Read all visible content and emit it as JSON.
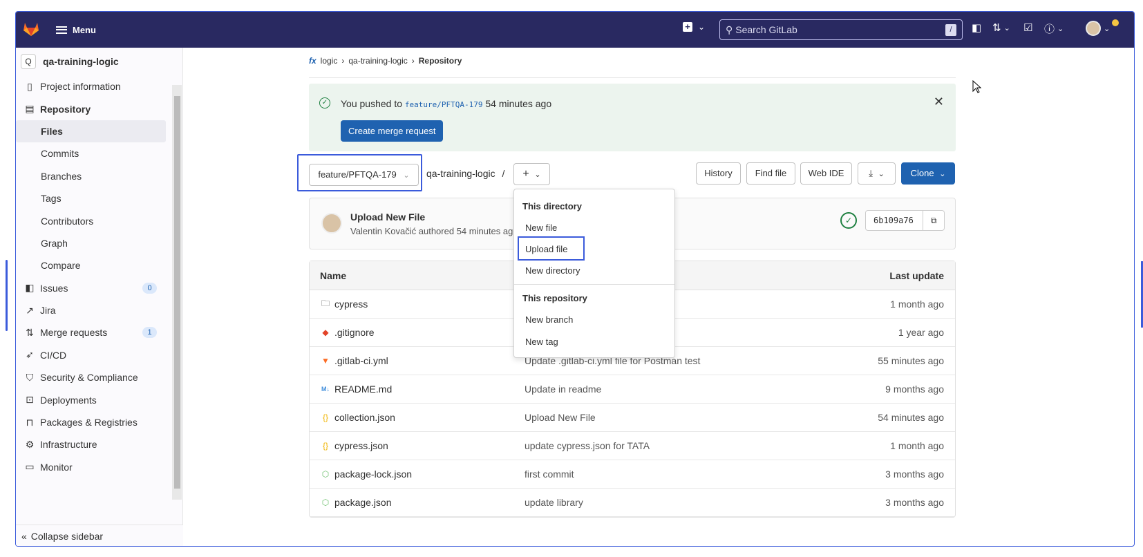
{
  "topbar": {
    "menu_label": "Menu",
    "search_placeholder": "Search GitLab",
    "search_shortcut": "/"
  },
  "sidebar": {
    "project_initial": "Q",
    "project_name": "qa-training-logic",
    "items": [
      {
        "label": "Project information",
        "icon": "info-icon"
      },
      {
        "label": "Repository",
        "icon": "doc-icon"
      },
      {
        "label": "Files"
      },
      {
        "label": "Commits"
      },
      {
        "label": "Branches"
      },
      {
        "label": "Tags"
      },
      {
        "label": "Contributors"
      },
      {
        "label": "Graph"
      },
      {
        "label": "Compare"
      },
      {
        "label": "Issues",
        "icon": "issues-icon",
        "count": "0"
      },
      {
        "label": "Jira",
        "icon": "external-link-icon"
      },
      {
        "label": "Merge requests",
        "icon": "merge-request-icon",
        "count": "1"
      },
      {
        "label": "CI/CD",
        "icon": "rocket-icon"
      },
      {
        "label": "Security & Compliance",
        "icon": "shield-icon"
      },
      {
        "label": "Deployments",
        "icon": "deployments-icon"
      },
      {
        "label": "Packages & Registries",
        "icon": "package-icon"
      },
      {
        "label": "Infrastructure",
        "icon": "cloud-gear-icon"
      },
      {
        "label": "Monitor",
        "icon": "monitor-icon"
      }
    ],
    "collapse_label": "Collapse sidebar"
  },
  "breadcrumb": {
    "group": "logic",
    "project": "qa-training-logic",
    "current": "Repository"
  },
  "alert": {
    "prefix": "You pushed to",
    "branch": "feature/PFTQA-179",
    "suffix": "54 minutes ago",
    "button": "Create merge request"
  },
  "toolbar": {
    "branch": "feature/PFTQA-179",
    "path": "qa-training-logic",
    "path_sep": "/",
    "history": "History",
    "find_file": "Find file",
    "web_ide": "Web IDE",
    "clone": "Clone"
  },
  "dropdown": {
    "section1": "This directory",
    "new_file": "New file",
    "upload_file": "Upload file",
    "new_directory": "New directory",
    "section2": "This repository",
    "new_branch": "New branch",
    "new_tag": "New tag"
  },
  "commit": {
    "title": "Upload New File",
    "author_line": "Valentin Kovačić authored 54 minutes ago",
    "sha": "6b109a76"
  },
  "table": {
    "headers": {
      "name": "Name",
      "last_commit": "",
      "last_update": "Last update"
    },
    "rows": [
      {
        "name": "cypress",
        "icon": "folder-icon",
        "commit": "",
        "updated": "1 month ago"
      },
      {
        "name": ".gitignore",
        "icon": "git-icon",
        "commit": "",
        "updated": "1 year ago"
      },
      {
        "name": ".gitlab-ci.yml",
        "icon": "gitlab-icon",
        "commit": "Update .gitlab-ci.yml file for Postman test",
        "updated": "55 minutes ago"
      },
      {
        "name": "README.md",
        "icon": "markdown-icon",
        "commit": "Update in readme",
        "updated": "9 months ago"
      },
      {
        "name": "collection.json",
        "icon": "json-icon",
        "commit": "Upload New File",
        "updated": "54 minutes ago"
      },
      {
        "name": "cypress.json",
        "icon": "json-icon",
        "commit": "update cypress.json for TATA",
        "updated": "1 month ago"
      },
      {
        "name": "package-lock.json",
        "icon": "node-icon",
        "commit": "first commit",
        "updated": "3 months ago"
      },
      {
        "name": "package.json",
        "icon": "node-icon",
        "commit": "update library",
        "updated": "3 months ago"
      }
    ]
  },
  "colors": {
    "topbar": "#292961",
    "primary": "#1f62b0",
    "alert_bg": "#ecf4ee",
    "highlight": "#3b5bdb"
  }
}
